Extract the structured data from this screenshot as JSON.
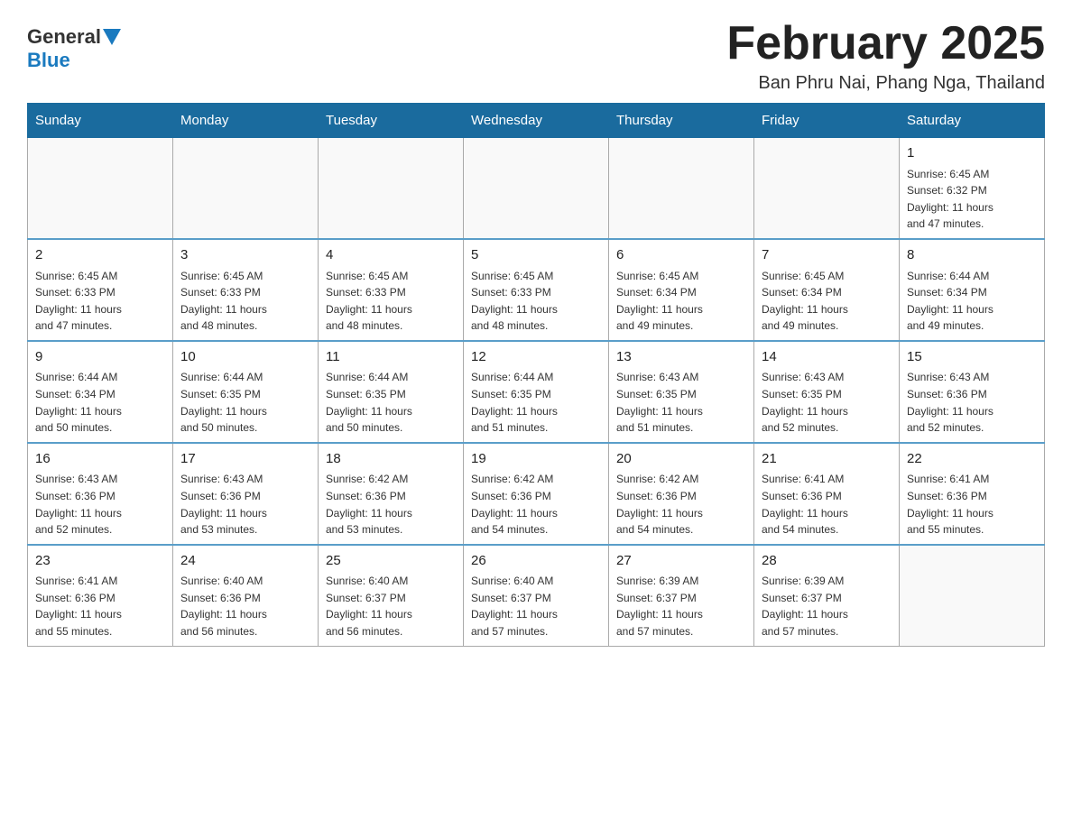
{
  "header": {
    "logo_general": "General",
    "logo_blue": "Blue",
    "title": "February 2025",
    "subtitle": "Ban Phru Nai, Phang Nga, Thailand"
  },
  "weekdays": [
    "Sunday",
    "Monday",
    "Tuesday",
    "Wednesday",
    "Thursday",
    "Friday",
    "Saturday"
  ],
  "weeks": [
    [
      {
        "day": "",
        "info": ""
      },
      {
        "day": "",
        "info": ""
      },
      {
        "day": "",
        "info": ""
      },
      {
        "day": "",
        "info": ""
      },
      {
        "day": "",
        "info": ""
      },
      {
        "day": "",
        "info": ""
      },
      {
        "day": "1",
        "info": "Sunrise: 6:45 AM\nSunset: 6:32 PM\nDaylight: 11 hours\nand 47 minutes."
      }
    ],
    [
      {
        "day": "2",
        "info": "Sunrise: 6:45 AM\nSunset: 6:33 PM\nDaylight: 11 hours\nand 47 minutes."
      },
      {
        "day": "3",
        "info": "Sunrise: 6:45 AM\nSunset: 6:33 PM\nDaylight: 11 hours\nand 48 minutes."
      },
      {
        "day": "4",
        "info": "Sunrise: 6:45 AM\nSunset: 6:33 PM\nDaylight: 11 hours\nand 48 minutes."
      },
      {
        "day": "5",
        "info": "Sunrise: 6:45 AM\nSunset: 6:33 PM\nDaylight: 11 hours\nand 48 minutes."
      },
      {
        "day": "6",
        "info": "Sunrise: 6:45 AM\nSunset: 6:34 PM\nDaylight: 11 hours\nand 49 minutes."
      },
      {
        "day": "7",
        "info": "Sunrise: 6:45 AM\nSunset: 6:34 PM\nDaylight: 11 hours\nand 49 minutes."
      },
      {
        "day": "8",
        "info": "Sunrise: 6:44 AM\nSunset: 6:34 PM\nDaylight: 11 hours\nand 49 minutes."
      }
    ],
    [
      {
        "day": "9",
        "info": "Sunrise: 6:44 AM\nSunset: 6:34 PM\nDaylight: 11 hours\nand 50 minutes."
      },
      {
        "day": "10",
        "info": "Sunrise: 6:44 AM\nSunset: 6:35 PM\nDaylight: 11 hours\nand 50 minutes."
      },
      {
        "day": "11",
        "info": "Sunrise: 6:44 AM\nSunset: 6:35 PM\nDaylight: 11 hours\nand 50 minutes."
      },
      {
        "day": "12",
        "info": "Sunrise: 6:44 AM\nSunset: 6:35 PM\nDaylight: 11 hours\nand 51 minutes."
      },
      {
        "day": "13",
        "info": "Sunrise: 6:43 AM\nSunset: 6:35 PM\nDaylight: 11 hours\nand 51 minutes."
      },
      {
        "day": "14",
        "info": "Sunrise: 6:43 AM\nSunset: 6:35 PM\nDaylight: 11 hours\nand 52 minutes."
      },
      {
        "day": "15",
        "info": "Sunrise: 6:43 AM\nSunset: 6:36 PM\nDaylight: 11 hours\nand 52 minutes."
      }
    ],
    [
      {
        "day": "16",
        "info": "Sunrise: 6:43 AM\nSunset: 6:36 PM\nDaylight: 11 hours\nand 52 minutes."
      },
      {
        "day": "17",
        "info": "Sunrise: 6:43 AM\nSunset: 6:36 PM\nDaylight: 11 hours\nand 53 minutes."
      },
      {
        "day": "18",
        "info": "Sunrise: 6:42 AM\nSunset: 6:36 PM\nDaylight: 11 hours\nand 53 minutes."
      },
      {
        "day": "19",
        "info": "Sunrise: 6:42 AM\nSunset: 6:36 PM\nDaylight: 11 hours\nand 54 minutes."
      },
      {
        "day": "20",
        "info": "Sunrise: 6:42 AM\nSunset: 6:36 PM\nDaylight: 11 hours\nand 54 minutes."
      },
      {
        "day": "21",
        "info": "Sunrise: 6:41 AM\nSunset: 6:36 PM\nDaylight: 11 hours\nand 54 minutes."
      },
      {
        "day": "22",
        "info": "Sunrise: 6:41 AM\nSunset: 6:36 PM\nDaylight: 11 hours\nand 55 minutes."
      }
    ],
    [
      {
        "day": "23",
        "info": "Sunrise: 6:41 AM\nSunset: 6:36 PM\nDaylight: 11 hours\nand 55 minutes."
      },
      {
        "day": "24",
        "info": "Sunrise: 6:40 AM\nSunset: 6:36 PM\nDaylight: 11 hours\nand 56 minutes."
      },
      {
        "day": "25",
        "info": "Sunrise: 6:40 AM\nSunset: 6:37 PM\nDaylight: 11 hours\nand 56 minutes."
      },
      {
        "day": "26",
        "info": "Sunrise: 6:40 AM\nSunset: 6:37 PM\nDaylight: 11 hours\nand 57 minutes."
      },
      {
        "day": "27",
        "info": "Sunrise: 6:39 AM\nSunset: 6:37 PM\nDaylight: 11 hours\nand 57 minutes."
      },
      {
        "day": "28",
        "info": "Sunrise: 6:39 AM\nSunset: 6:37 PM\nDaylight: 11 hours\nand 57 minutes."
      },
      {
        "day": "",
        "info": ""
      }
    ]
  ]
}
